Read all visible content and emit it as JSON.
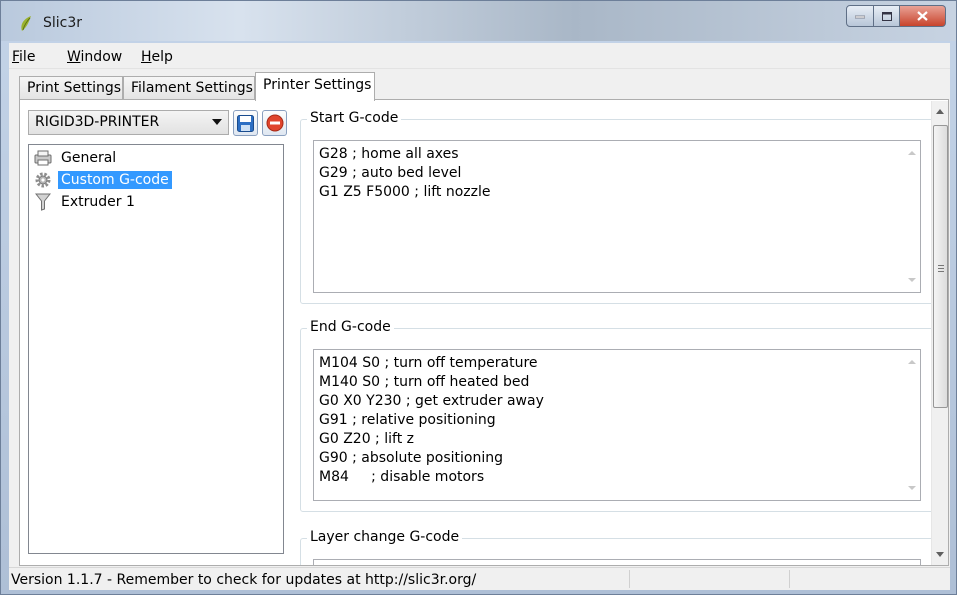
{
  "window": {
    "title": "Slic3r"
  },
  "menu": {
    "items": [
      {
        "label": "File",
        "accel": "F",
        "rest": "ile"
      },
      {
        "label": "Window",
        "accel": "W",
        "rest": "indow"
      },
      {
        "label": "Help",
        "accel": "H",
        "rest": "elp"
      }
    ]
  },
  "tabs": [
    {
      "label": "Print Settings",
      "active": false
    },
    {
      "label": "Filament Settings",
      "active": false
    },
    {
      "label": "Printer Settings",
      "active": true
    }
  ],
  "preset": {
    "selected": "RIGID3D-PRINTER",
    "save_icon": "save-icon",
    "delete_icon": "delete-icon"
  },
  "tree": {
    "items": [
      {
        "label": "General",
        "icon": "printer-icon",
        "selected": false
      },
      {
        "label": "Custom G-code",
        "icon": "gear-icon",
        "selected": true
      },
      {
        "label": "Extruder 1",
        "icon": "funnel-icon",
        "selected": false
      }
    ]
  },
  "sections": {
    "start": {
      "title": "Start G-code",
      "lines": [
        "G28 ; home all axes",
        "G29 ; auto bed level",
        "G1 Z5 F5000 ; lift nozzle"
      ]
    },
    "end": {
      "title": "End G-code",
      "lines": [
        "M104 S0 ; turn off temperature",
        "M140 S0 ; turn off heated bed",
        "G0 X0 Y230 ; get extruder away",
        "G91 ; relative positioning",
        "G0 Z20 ; lift z",
        "G90 ; absolute positioning",
        "M84     ; disable motors"
      ]
    },
    "layer": {
      "title": "Layer change G-code"
    }
  },
  "status": {
    "text": "Version 1.1.7 - Remember to check for updates at http://slic3r.org/"
  },
  "colors": {
    "selection": "#3399ff",
    "close_button": "#c8442c"
  }
}
